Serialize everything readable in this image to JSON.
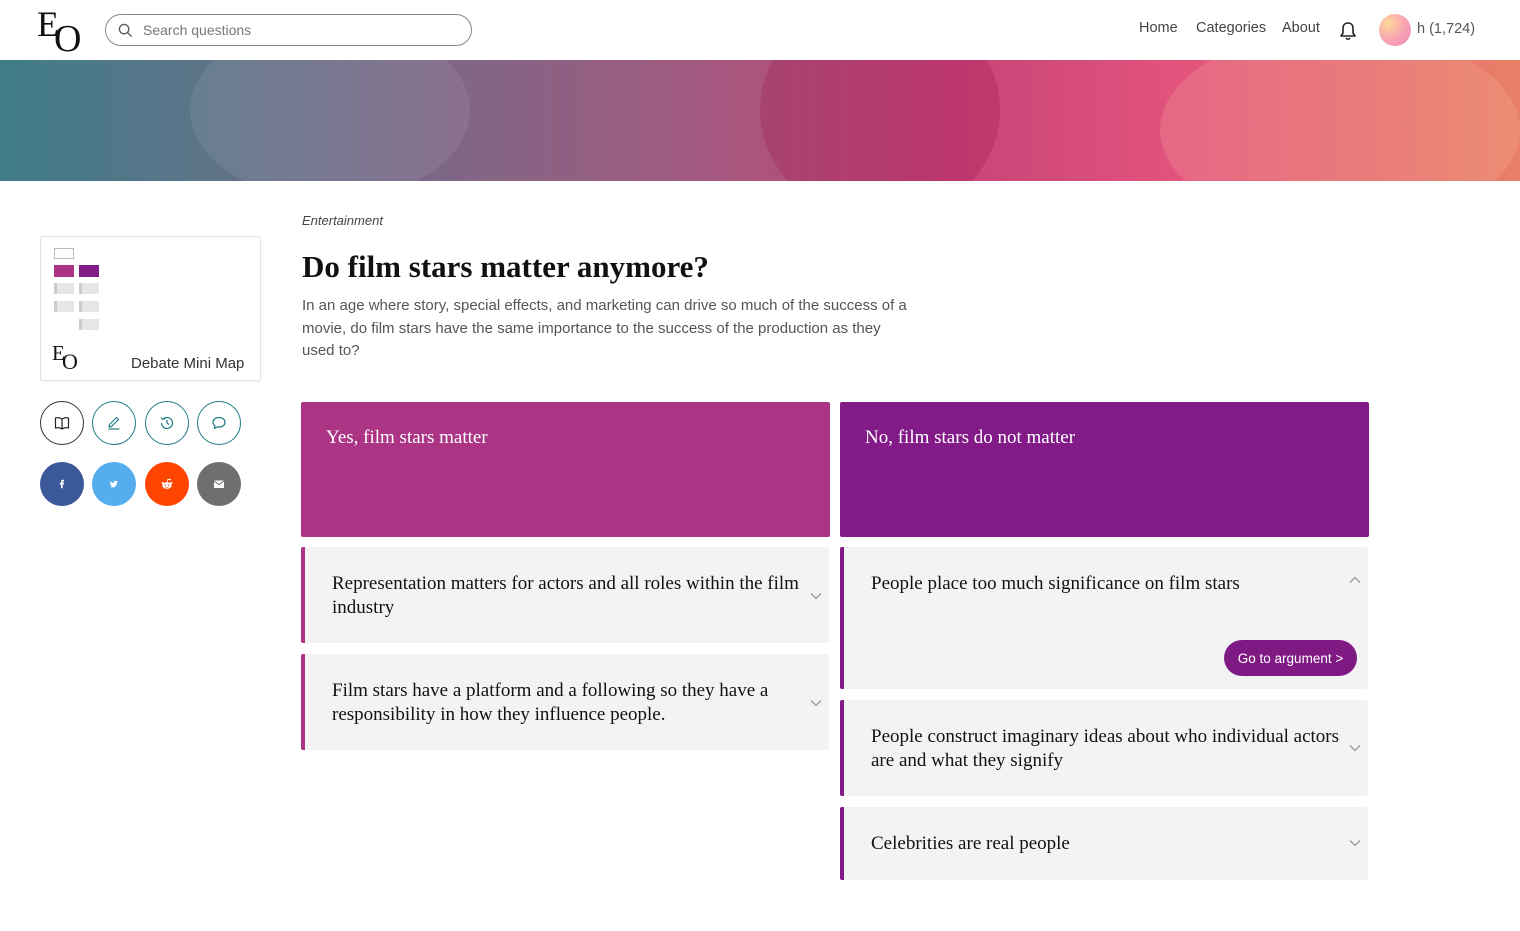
{
  "header": {
    "logo_text": "EO",
    "search_placeholder": "Search questions",
    "nav": {
      "home": "Home",
      "categories": "Categories",
      "about": "About"
    },
    "user_label": "h (1,724)"
  },
  "sidebar": {
    "minimap_label": "Debate Mini Map",
    "action_icons": [
      "book-icon",
      "pencil-icon",
      "history-icon",
      "comment-icon"
    ],
    "share_icons": [
      {
        "name": "facebook-icon",
        "glyph": "f",
        "color": "#3b5998"
      },
      {
        "name": "twitter-icon",
        "glyph": "t",
        "color": "#55acee"
      },
      {
        "name": "reddit-icon",
        "glyph": "r",
        "color": "#ff4500"
      },
      {
        "name": "email-icon",
        "glyph": "e",
        "color": "#6f6f6f"
      }
    ]
  },
  "debate": {
    "category": "Entertainment",
    "title": "Do film stars matter anymore?",
    "description": "In an age where story, special effects, and marketing can drive so much of the success of a movie, do film stars have the same importance to the success of the production as they used to?",
    "yes": {
      "heading": "Yes, film stars matter",
      "color": "#ab3584",
      "arguments": [
        "Representation matters for actors and all roles within the film industry",
        "Film stars have a platform and a following so they have a responsibility in how they influence people."
      ]
    },
    "no": {
      "heading": "No, film stars do not matter",
      "color": "#821b88",
      "arguments": [
        "People place too much significance on film stars",
        "People construct imaginary ideas about who individual actors are and what they signify",
        "Celebrities are real people"
      ],
      "go_button": "Go to argument >"
    }
  }
}
